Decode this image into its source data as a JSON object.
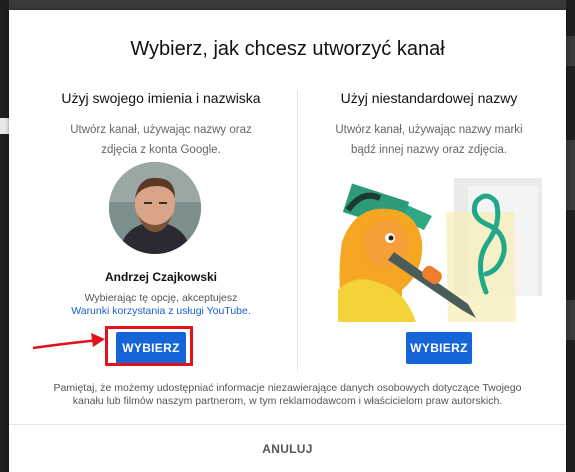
{
  "dialog": {
    "title": "Wybierz, jak chcesz utworzyć kanał",
    "left": {
      "heading": "Użyj swojego imienia i nazwiska",
      "description": "Utwórz kanał, używając nazwy oraz zdjęcia z konta Google.",
      "user_name": "Andrzej Czajkowski",
      "terms_prefix": "Wybierając tę opcję, akceptujesz",
      "terms_link": "Warunki korzystania z usługi YouTube.",
      "button_label": "WYBIERZ"
    },
    "right": {
      "heading": "Użyj niestandardowej nazwy",
      "description": "Utwórz kanał, używając nazwy marki bądź innej nazwy oraz zdjęcia.",
      "button_label": "WYBIERZ"
    },
    "notice": "Pamiętaj, że możemy udostępniać informacje niezawierające danych osobowych dotyczące Twojego kanału lub filmów naszym partnerom, w tym reklamodawcom i właścicielom praw autorskich.",
    "cancel_label": "ANULUJ"
  },
  "colors": {
    "primary_button": "#1565d8",
    "annotation_red": "#e3111b",
    "link": "#1a5fd0"
  },
  "icons": {
    "avatar": "user-photo",
    "illustration": "person-drawing-illustration",
    "annotation": "red-arrow"
  }
}
